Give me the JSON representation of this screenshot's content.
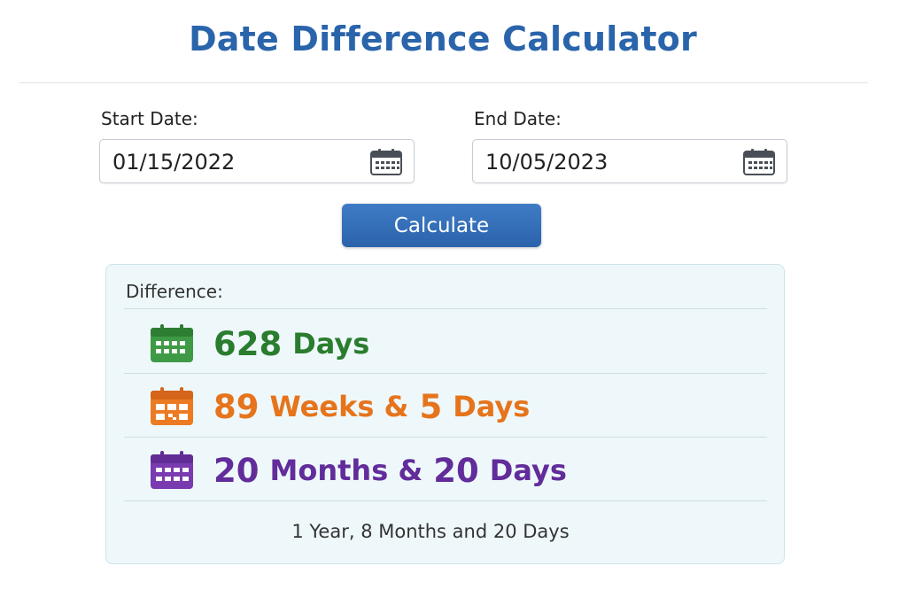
{
  "page": {
    "title": "Date Difference Calculator"
  },
  "form": {
    "start_label": "Start Date:",
    "start_value": "01/15/2022",
    "end_label": "End Date:",
    "end_value": "10/05/2023",
    "calendar_icon": "calendar-icon",
    "calculate_label": "Calculate"
  },
  "result": {
    "heading": "Difference:",
    "days": {
      "value": "628",
      "unit": "Days",
      "color": "#2a7d2e",
      "icon": "calendar-icon"
    },
    "weeks": {
      "weeks_value": "89",
      "weeks_unit": "Weeks &",
      "days_value": "5",
      "days_unit": "Days",
      "color": "#e6741c",
      "icon": "calendar-week-icon"
    },
    "months": {
      "months_value": "20",
      "months_unit": "Months &",
      "days_value": "20",
      "days_unit": "Days",
      "color": "#622c9a",
      "icon": "calendar-month-icon"
    },
    "summary": "1 Year, 8 Months and 20 Days"
  },
  "colors": {
    "accent": "#2a64ab",
    "panel_bg": "#eef8fb"
  }
}
